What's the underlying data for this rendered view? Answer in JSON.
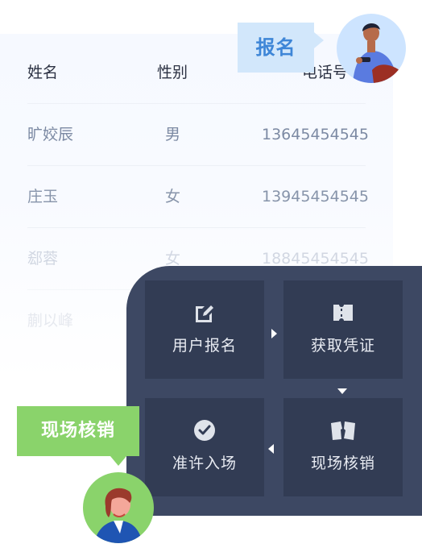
{
  "registration_table": {
    "columns": [
      "姓名",
      "性别",
      "电话号"
    ],
    "rows": [
      {
        "name": "旷姣辰",
        "gender": "男",
        "phone": "13645454545"
      },
      {
        "name": "庄玉",
        "gender": "女",
        "phone": "13945454545"
      },
      {
        "name": "郄蓉",
        "gender": "女",
        "phone": "18845454545"
      },
      {
        "name": "蒯以峰",
        "gender": "",
        "phone": ""
      }
    ],
    "text_colors": [
      "#7c8aa3",
      "#8794aa",
      "#d1d7e2",
      "#e6e9ef"
    ]
  },
  "register_tag": {
    "label": "报名",
    "color": "#d2e7fb",
    "text_color": "#3e86d7"
  },
  "process": {
    "steps": [
      {
        "label": "用户报名",
        "icon": "edit-form-icon"
      },
      {
        "label": "获取凭证",
        "icon": "ticket-icon"
      },
      {
        "label": "准许入场",
        "icon": "check-circle-icon"
      },
      {
        "label": "现场核销",
        "icon": "torn-ticket-icon"
      }
    ],
    "panel_color": "#3d4863",
    "card_color": "#323c54"
  },
  "verify_tag": {
    "label": "现场核销",
    "color": "#8ad36b"
  }
}
